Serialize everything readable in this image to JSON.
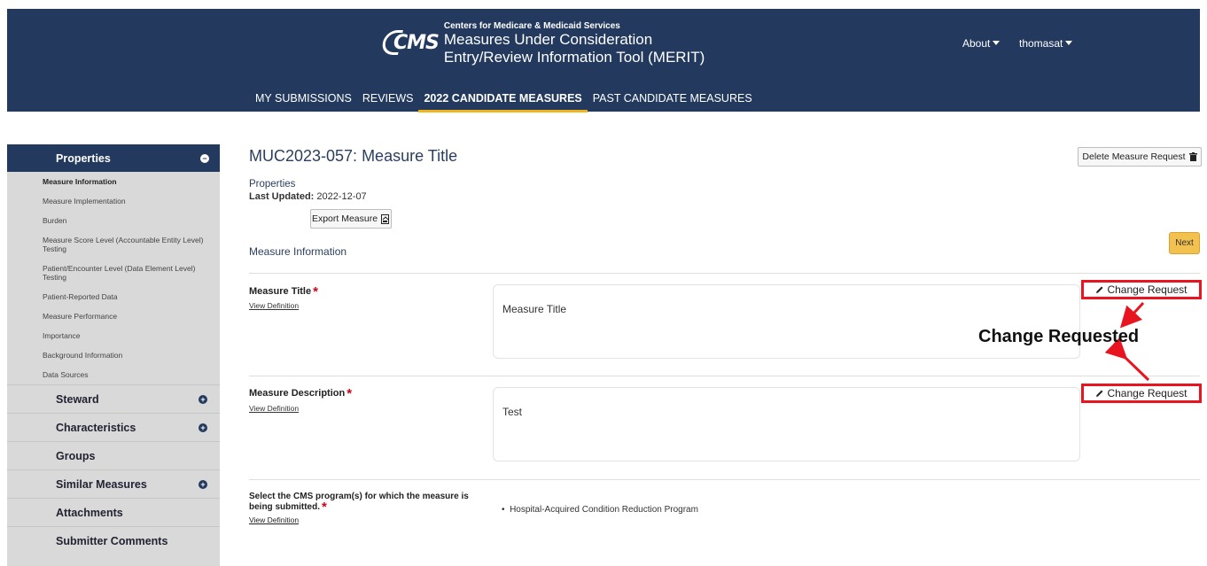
{
  "header": {
    "org": "Centers for Medicare & Medicaid Services",
    "logo_text": "CMS",
    "title_line1": "Measures Under Consideration",
    "title_line2": "Entry/Review Information Tool (MERIT)",
    "about_label": "About",
    "user_label": "thomasat",
    "bg_color": "#233a5e",
    "accent_color": "#f0b41c"
  },
  "nav": {
    "items": [
      {
        "label": "MY SUBMISSIONS"
      },
      {
        "label": "REVIEWS"
      },
      {
        "label": "2022 CANDIDATE MEASURES",
        "active": true
      },
      {
        "label": "PAST CANDIDATE MEASURES"
      }
    ]
  },
  "sidebar": {
    "properties_label": "Properties",
    "sub_items": [
      {
        "label": "Measure Information",
        "active": true
      },
      {
        "label": "Measure Implementation"
      },
      {
        "label": "Burden"
      },
      {
        "label": "Measure Score Level (Accountable Entity Level) Testing"
      },
      {
        "label": "Patient/Encounter Level (Data Element Level) Testing"
      },
      {
        "label": "Patient-Reported Data"
      },
      {
        "label": "Measure Performance"
      },
      {
        "label": "Importance"
      },
      {
        "label": "Background Information"
      },
      {
        "label": "Data Sources"
      }
    ],
    "sections": [
      {
        "label": "Steward",
        "expandable": true
      },
      {
        "label": "Characteristics",
        "expandable": true
      },
      {
        "label": "Groups",
        "expandable": false
      },
      {
        "label": "Similar Measures",
        "expandable": true
      },
      {
        "label": "Attachments",
        "expandable": false
      },
      {
        "label": "Submitter Comments",
        "expandable": false
      }
    ]
  },
  "main": {
    "title": "MUC2023-057: Measure Title",
    "properties_label": "Properties",
    "last_updated_label": "Last Updated:",
    "last_updated_value": "2022-12-07",
    "export_label": "Export Measure",
    "delete_label": "Delete Measure Request",
    "next_label": "Next",
    "section_title": "Measure Information",
    "fields": [
      {
        "label": "Measure Title",
        "view_definition": "View Definition",
        "value": "Measure Title",
        "change_request": "Change Request"
      },
      {
        "label": "Measure Description",
        "view_definition": "View Definition",
        "value": "Test",
        "change_request": "Change Request"
      }
    ],
    "program": {
      "label": "Select the CMS program(s) for which the measure is being submitted.",
      "view_definition": "View Definition",
      "value": "Hospital-Acquired Condition Reduction Program"
    }
  },
  "annotation": {
    "label": "Change Requested",
    "color": "#e8141f"
  }
}
